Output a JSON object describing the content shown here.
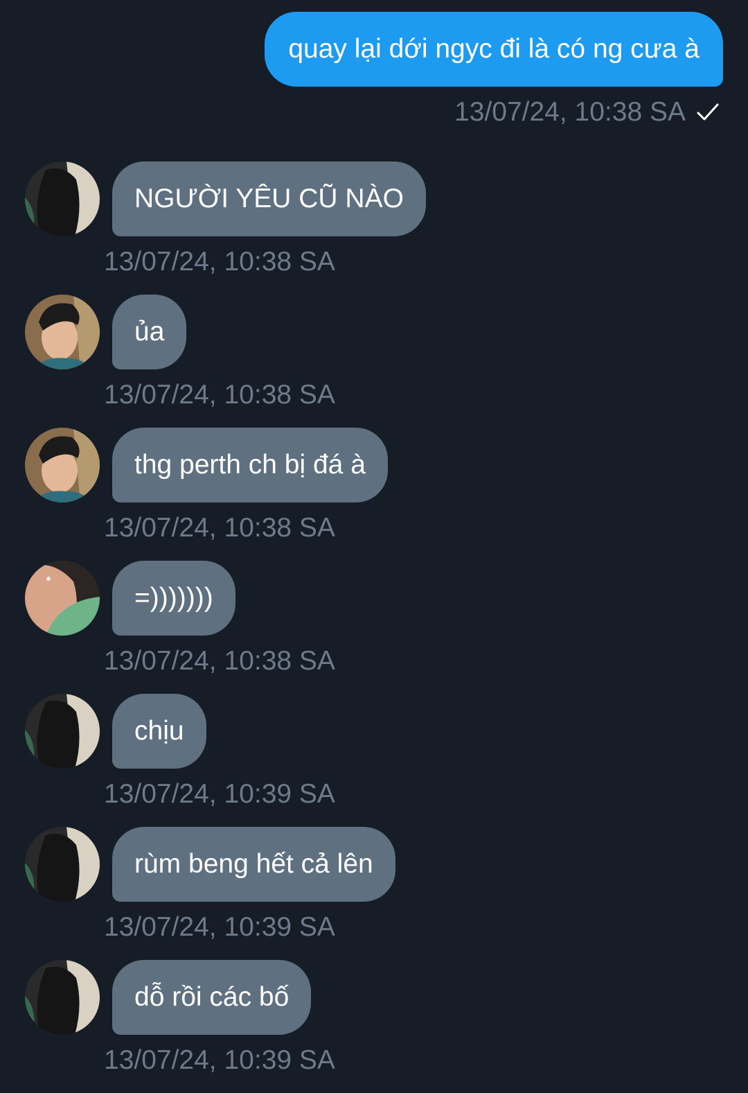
{
  "sent_message": {
    "text": "quay lại dới ngyc đi là có ng cưa à",
    "time": "13/07/24, 10:38 SA",
    "status_icon": "check-icon",
    "bubble_color": "#1d9bf0"
  },
  "messages": [
    {
      "avatar": "avatar-dark-icon",
      "text": "NGƯỜI YÊU CŨ NÀO",
      "time": "13/07/24, 10:38 SA"
    },
    {
      "avatar": "avatar-boy-icon",
      "text": "ủa",
      "time": "13/07/24, 10:38 SA"
    },
    {
      "avatar": "avatar-boy-icon",
      "text": "thg perth ch bị đá à",
      "time": "13/07/24, 10:38 SA"
    },
    {
      "avatar": "avatar-green-icon",
      "text": "=)))))))",
      "time": "13/07/24, 10:38 SA"
    },
    {
      "avatar": "avatar-dark-icon",
      "text": "chịu",
      "time": "13/07/24, 10:39 SA"
    },
    {
      "avatar": "avatar-dark-icon",
      "text": "rùm beng hết cả lên",
      "time": "13/07/24, 10:39 SA"
    },
    {
      "avatar": "avatar-dark-icon",
      "text": "dỗ rồi các bố",
      "time": "13/07/24, 10:39 SA"
    }
  ],
  "colors": {
    "background": "#161d27",
    "received_bubble": "#5f7081",
    "timestamp": "#6d7a8a"
  }
}
